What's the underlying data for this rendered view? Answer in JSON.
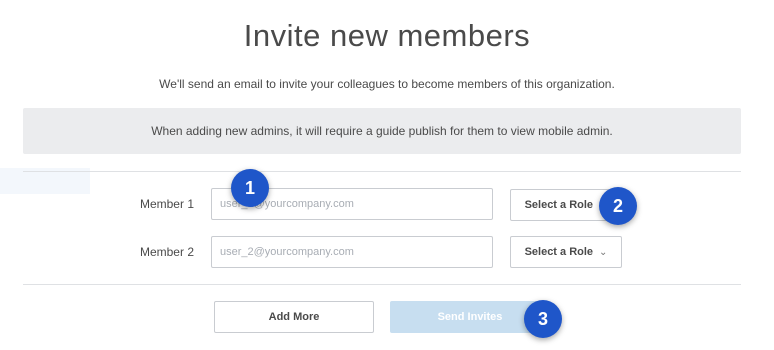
{
  "title": "Invite new members",
  "subtitle": "We'll send an email to invite your colleagues to become members of this organization.",
  "notice": "When adding new admins, it will require a guide publish for them to view mobile admin.",
  "members": [
    {
      "label": "Member 1",
      "email_value": "",
      "email_placeholder": "user_1@yourcompany.com",
      "role": "Select a Role"
    },
    {
      "label": "Member 2",
      "email_value": "",
      "email_placeholder": "user_2@yourcompany.com",
      "role": "Select a Role"
    }
  ],
  "buttons": {
    "add_more": "Add More",
    "send_invites": "Send Invites"
  },
  "badges": [
    "1",
    "2",
    "3"
  ],
  "icons": {
    "chevron": "chevron-down-icon"
  },
  "colors": {
    "badge": "#1f56c9",
    "send_disabled": "#c7def0",
    "notice_bg": "#ebecee"
  }
}
